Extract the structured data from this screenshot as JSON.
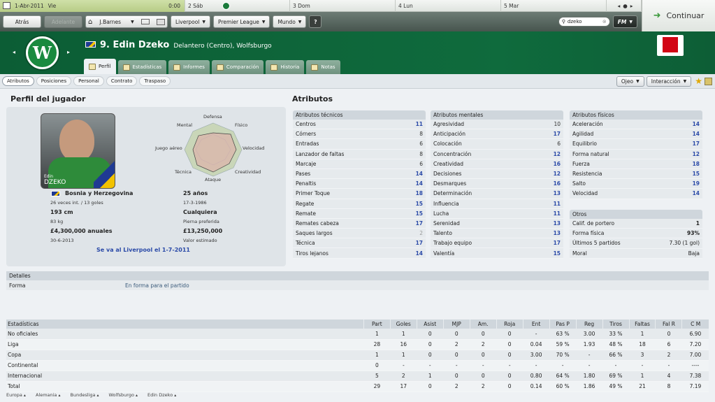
{
  "calendar": {
    "today_date": "1-Abr-2011",
    "today_day": "Vie",
    "time": "0:00",
    "days": [
      "2 Sáb",
      "3 Dom",
      "4 Lun",
      "5 Mar"
    ]
  },
  "continue_label": "Continuar",
  "nav": {
    "back": "Atrás",
    "forward": "Adelante",
    "manager": "J.Barnes",
    "club": "Liverpool",
    "league": "Premier League",
    "world": "Mundo",
    "help": "?",
    "search_value": "dzeko",
    "fm": "FM"
  },
  "player": {
    "number_name": "9. Edin Dzeko",
    "position_club": "Delantero (Centro), Wolfsburgo",
    "club_letter": "W",
    "photo_caption_first": "Edin",
    "photo_caption_last": "DZEKO"
  },
  "tabs": [
    "Perfil",
    "Estadísticas",
    "Informes",
    "Comparación",
    "Historia",
    "Notas"
  ],
  "subtabs": [
    "Atributos",
    "Posiciones",
    "Personal",
    "Contrato",
    "Traspaso"
  ],
  "right_controls": {
    "eye": "Ojeo",
    "interaction": "Interacción"
  },
  "profile": {
    "title": "Perfil del jugador",
    "radar_labels": {
      "top": "Defensa",
      "tr": "Físico",
      "r": "Velocidad",
      "br": "Creatividad",
      "b": "Ataque",
      "bl": "Técnica",
      "l": "Juego aéreo",
      "tl": "Mental"
    },
    "nation": "Bosnia y Herzegovina",
    "caps": "26 veces int. / 13 goles",
    "age": "25 años",
    "dob": "17-3-1986",
    "height": "193 cm",
    "weight": "83 kg",
    "foot": "Cualquiera",
    "foot_label": "Pierna preferida",
    "wage": "£4,300,000 anuales",
    "contract_end": "30-6-2013",
    "value": "£13,250,000",
    "value_label": "Valor estimado",
    "transfer_note": "Se va al Liverpool el 1-7-2011"
  },
  "attributes": {
    "title": "Atributos",
    "technical": {
      "title": "Atributos técnicos",
      "rows": [
        [
          "Centros",
          "11"
        ],
        [
          "Córners",
          "8"
        ],
        [
          "Entradas",
          "6"
        ],
        [
          "Lanzador de faltas",
          "8"
        ],
        [
          "Marcaje",
          "6"
        ],
        [
          "Pases",
          "14"
        ],
        [
          "Penaltis",
          "14"
        ],
        [
          "Primer Toque",
          "18"
        ],
        [
          "Regate",
          "15"
        ],
        [
          "Remate",
          "15"
        ],
        [
          "Remates cabeza",
          "17"
        ],
        [
          "Saques largos",
          "2"
        ],
        [
          "Técnica",
          "17"
        ],
        [
          "Tiros lejanos",
          "14"
        ]
      ]
    },
    "mental": {
      "title": "Atributos mentales",
      "rows": [
        [
          "Agresividad",
          "10"
        ],
        [
          "Anticipación",
          "17"
        ],
        [
          "Colocación",
          "6"
        ],
        [
          "Concentración",
          "12"
        ],
        [
          "Creatividad",
          "16"
        ],
        [
          "Decisiones",
          "12"
        ],
        [
          "Desmarques",
          "16"
        ],
        [
          "Determinación",
          "13"
        ],
        [
          "Influencia",
          "11"
        ],
        [
          "Lucha",
          "11"
        ],
        [
          "Serenidad",
          "13"
        ],
        [
          "Talento",
          "13"
        ],
        [
          "Trabajo equipo",
          "17"
        ],
        [
          "Valentía",
          "15"
        ]
      ]
    },
    "physical": {
      "title": "Atributos físicos",
      "rows": [
        [
          "Aceleración",
          "14"
        ],
        [
          "Agilidad",
          "14"
        ],
        [
          "Equilibrio",
          "17"
        ],
        [
          "Forma natural",
          "12"
        ],
        [
          "Fuerza",
          "18"
        ],
        [
          "Resistencia",
          "15"
        ],
        [
          "Salto",
          "19"
        ],
        [
          "Velocidad",
          "14"
        ]
      ]
    },
    "other": {
      "title": "Otros",
      "rows": [
        [
          "Calif. de portero",
          "1"
        ],
        [
          "Forma física",
          "93%"
        ],
        [
          "Últimos 5 partidos",
          "7.30 (1 gol)"
        ],
        [
          "Moral",
          "Baja"
        ]
      ]
    }
  },
  "details": {
    "title": "Detalles",
    "label": "Forma",
    "value": "En forma para el partido"
  },
  "stats": {
    "headers": [
      "Estadísticas",
      "Part",
      "Goles",
      "Asist",
      "MJP",
      "Am.",
      "Roja",
      "Ent",
      "Pas P",
      "Reg",
      "Tiros",
      "Faltas",
      "Fal R",
      "C M"
    ],
    "rows": [
      [
        "No oficiales",
        "1",
        "1",
        "0",
        "0",
        "0",
        "0",
        "-",
        "63 %",
        "3.00",
        "33 %",
        "1",
        "0",
        "6.90"
      ],
      [
        "Liga",
        "28",
        "16",
        "0",
        "2",
        "2",
        "0",
        "0.04",
        "59 %",
        "1.93",
        "48 %",
        "18",
        "6",
        "7.20"
      ],
      [
        "Copa",
        "1",
        "1",
        "0",
        "0",
        "0",
        "0",
        "3.00",
        "70 %",
        "-",
        "66 %",
        "3",
        "2",
        "7.00"
      ],
      [
        "Continental",
        "0",
        "-",
        "-",
        "-",
        "-",
        "-",
        "-",
        "-",
        "-",
        "-",
        "-",
        "-",
        "----"
      ],
      [
        "Internacional",
        "5",
        "2",
        "1",
        "0",
        "0",
        "0",
        "0.80",
        "64 %",
        "1.80",
        "69 %",
        "1",
        "4",
        "7.38"
      ],
      [
        "Total",
        "29",
        "17",
        "0",
        "2",
        "2",
        "0",
        "0.14",
        "60 %",
        "1.86",
        "49 %",
        "21",
        "8",
        "7.19"
      ]
    ]
  },
  "breadcrumbs": [
    "Europa",
    "Alemania",
    "Bundesliga",
    "Wolfsburgo",
    "Edin Dzeko"
  ]
}
